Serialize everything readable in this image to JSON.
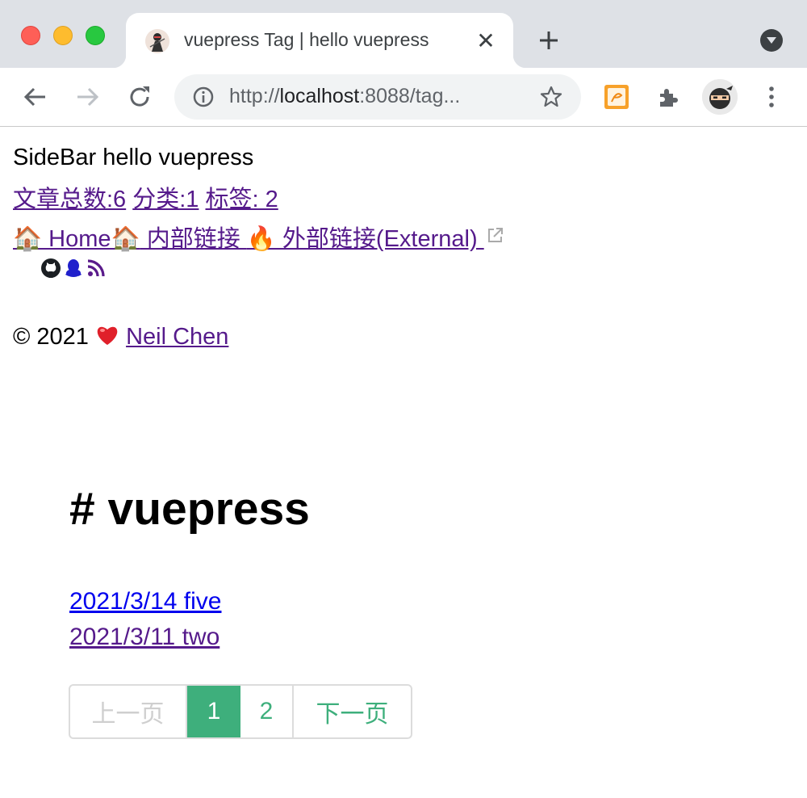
{
  "browser": {
    "tab": {
      "title": "vuepress Tag | hello vuepress",
      "close_label": "✕"
    },
    "address": {
      "scheme": "http://",
      "host": "localhost",
      "rest": ":8088/tag..."
    }
  },
  "page": {
    "site_title": "SideBar hello vuepress",
    "stats": {
      "articles": "文章总数:6",
      "categories": "分类:1",
      "tags": "标签: 2"
    },
    "nav": {
      "home": "🏠 Home🏠",
      "internal": " 内部链接 ",
      "external": "🔥 外部链接(External) "
    },
    "footer": {
      "copyright": "© 2021 ",
      "heart": "❤",
      "author": "Neil Chen"
    },
    "tag_heading": "# vuepress",
    "posts": [
      {
        "label": "2021/3/14 five"
      },
      {
        "label": "2021/3/11 two"
      }
    ],
    "pagination": {
      "prev": "上一页",
      "pages": [
        "1",
        "2"
      ],
      "next": "下一页",
      "current": "1"
    },
    "colors": {
      "accent": "#3eaf7c",
      "visited_link": "#551a8b",
      "link": "#0000ee"
    }
  }
}
